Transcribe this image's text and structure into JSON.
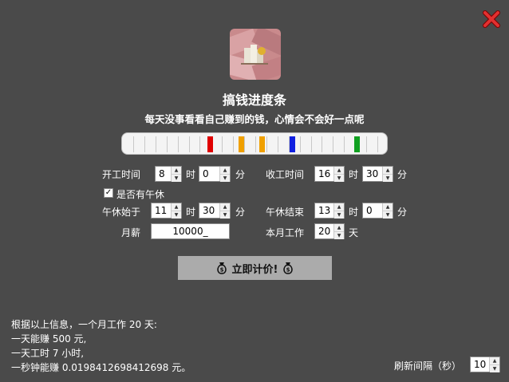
{
  "app": {
    "title": "搞钱进度条",
    "subtitle": "每天没事看看自己赚到的钱，心情会不会好一点呢"
  },
  "progress": {
    "segments": 22,
    "markers": [
      {
        "position": 0.315,
        "color": "#e00000"
      },
      {
        "position": 0.44,
        "color": "#f0a000"
      },
      {
        "position": 0.525,
        "color": "#f0a000"
      },
      {
        "position": 0.65,
        "color": "#1020e0"
      },
      {
        "position": 0.915,
        "color": "#10a020"
      }
    ]
  },
  "form": {
    "start_label": "开工时间",
    "end_label": "收工时间",
    "hour_unit": "时",
    "minute_unit": "分",
    "start_hour": "8",
    "start_minute": "0",
    "end_hour": "16",
    "end_minute": "30",
    "lunch_checkbox_label": "是否有午休",
    "lunch_checked": true,
    "lunch_start_label": "午休始于",
    "lunch_end_label": "午休结束",
    "lunch_start_hour": "11",
    "lunch_start_minute": "30",
    "lunch_end_hour": "13",
    "lunch_end_minute": "0",
    "salary_label": "月薪",
    "salary_value": "10000_",
    "workdays_label": "本月工作",
    "workdays_value": "20",
    "workdays_unit": "天"
  },
  "calc_button": {
    "label": "立即计价!"
  },
  "info": {
    "line1": "根据以上信息，一个月工作 20 天:",
    "line2": "一天能赚 500 元,",
    "line3": "一天工时 7 小时,",
    "line4": "一秒钟能赚 0.0198412698412698 元。"
  },
  "refresh": {
    "label": "刷新间隔（秒）",
    "value": "10"
  }
}
